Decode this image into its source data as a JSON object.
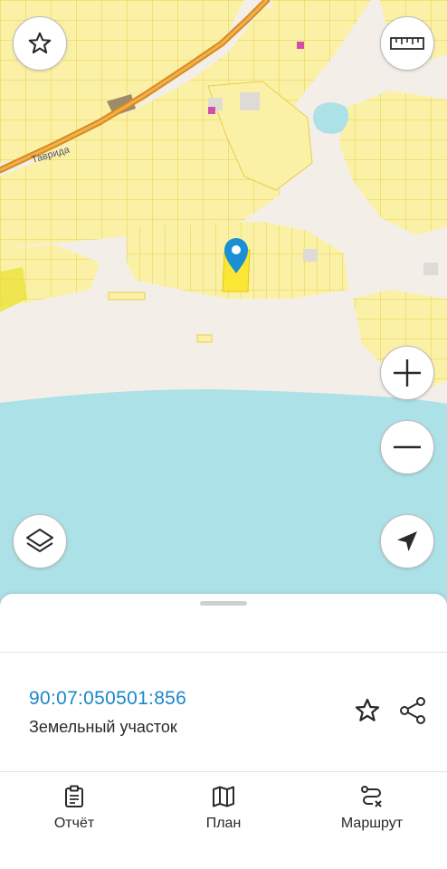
{
  "map": {
    "road_label": "Таврида",
    "colors": {
      "land": "#f3efe8",
      "parcel_fill": "#fbf1a6",
      "parcel_stroke": "#e6cf4a",
      "selected_parcel": "#fbe635",
      "sea": "#ade1e8",
      "highway": "#d98a1e",
      "marker": "#1a8fd1"
    }
  },
  "controls": {
    "favorite": "star-icon",
    "ruler": "ruler-icon",
    "zoom_in": "plus-icon",
    "zoom_out": "minus-icon",
    "layers": "layers-icon",
    "locate": "navigation-arrow-icon"
  },
  "sheet": {
    "cadastral_number": "90:07:050501:856",
    "property_type": "Земельный участок",
    "accent_color": "#1a88c9"
  },
  "tabs": [
    {
      "label": "Отчёт",
      "icon": "clipboard-icon"
    },
    {
      "label": "План",
      "icon": "map-icon"
    },
    {
      "label": "Маршрут",
      "icon": "route-icon"
    }
  ]
}
